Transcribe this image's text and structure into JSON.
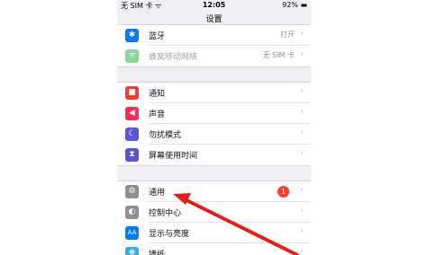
{
  "statusbar": {
    "carrier": "无 SIM 卡 ᯤ",
    "time": "12:05",
    "battery": "92%"
  },
  "nav": {
    "title": "设置"
  },
  "group1": [
    {
      "label": "蓝牙",
      "value": "打开",
      "icon": "bluetooth-icon",
      "color": "#007aff",
      "glyph": "✱",
      "dim": false
    },
    {
      "label": "蜂窝移动网络",
      "value": "无 SIM 卡",
      "icon": "cellular-icon",
      "color": "#8fd49a",
      "glyph": "ᯤ",
      "dim": true
    }
  ],
  "group2": [
    {
      "label": "通知",
      "icon": "notifications-icon",
      "color": "#ff3b30",
      "glyph": "■"
    },
    {
      "label": "声音",
      "icon": "sounds-icon",
      "color": "#ff2d55",
      "glyph": "◀"
    },
    {
      "label": "勿扰模式",
      "icon": "do-not-disturb-icon",
      "color": "#5856d6",
      "glyph": "☾"
    },
    {
      "label": "屏幕使用时间",
      "icon": "screen-time-icon",
      "color": "#5856d6",
      "glyph": "⧗"
    }
  ],
  "group3": [
    {
      "label": "通用",
      "icon": "general-gear-icon",
      "color": "#8e8e93",
      "glyph": "⚙",
      "badge": "1"
    },
    {
      "label": "控制中心",
      "icon": "control-center-icon",
      "color": "#8e8e93",
      "glyph": "◐"
    },
    {
      "label": "显示与亮度",
      "icon": "display-brightness-icon",
      "color": "#007aff",
      "glyph": "AA"
    },
    {
      "label": "墙纸",
      "icon": "wallpaper-icon",
      "color": "#32ade6",
      "glyph": "❋"
    }
  ],
  "colors": {
    "arrow": "#e0201b",
    "badge": "#ff3b30"
  }
}
